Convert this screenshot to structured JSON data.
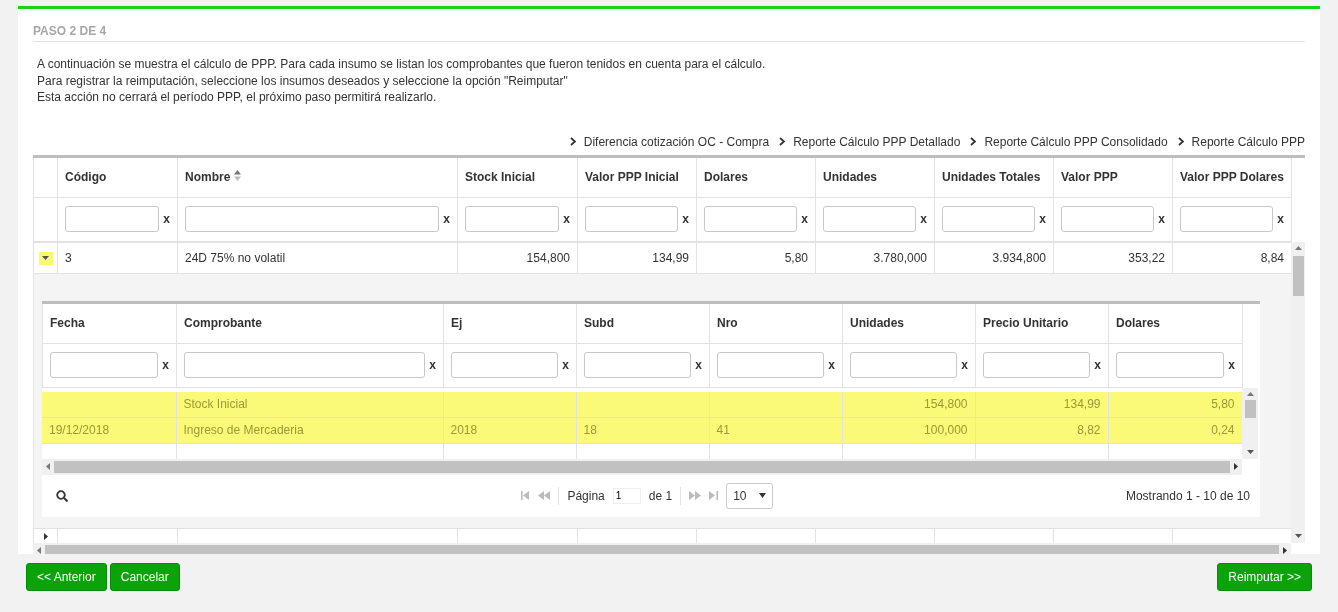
{
  "step_title": "PASO 2 DE 4",
  "intro": [
    "A continuación se muestra el cálculo de PPP. Para cada insumo se listan los comprobantes que fueron tenidos en cuenta para el cálculo.",
    "Para registrar la reimputación, seleccione los insumos deseados y seleccione la opción \"Reimputar\"",
    "Esta acción no cerrará el período PPP, el próximo paso permitirá realizarlo."
  ],
  "report_links": [
    "Diferencia cotización OC - Compra",
    "Reporte Cálculo PPP Detallado",
    "Reporte Cálculo PPP Consolidado",
    "Reporte Cálculo PPP"
  ],
  "grid": {
    "columns": [
      {
        "label": "Código",
        "kind": "text",
        "sortable": false,
        "filter_clear": "x"
      },
      {
        "label": "Nombre",
        "kind": "text",
        "sortable": true,
        "filter_clear": "x"
      },
      {
        "label": "Stock Inicial",
        "kind": "number",
        "sortable": false,
        "filter_clear": "x"
      },
      {
        "label": "Valor PPP Inicial",
        "kind": "number",
        "sortable": false,
        "filter_clear": "x"
      },
      {
        "label": "Dolares",
        "kind": "number",
        "sortable": false,
        "filter_clear": "x"
      },
      {
        "label": "Unidades",
        "kind": "number",
        "sortable": false,
        "filter_clear": "x"
      },
      {
        "label": "Unidades Totales",
        "kind": "number",
        "sortable": false,
        "filter_clear": "x"
      },
      {
        "label": "Valor PPP",
        "kind": "number",
        "sortable": false,
        "filter_clear": "x"
      },
      {
        "label": "Valor PPP Dolares",
        "kind": "number",
        "sortable": false,
        "filter_clear": "x"
      }
    ],
    "rows": [
      {
        "expanded": true,
        "cells": [
          "3",
          "24D 75% no volatil",
          "154,800",
          "134,99",
          "5,80",
          "3.780,000",
          "3.934,800",
          "353,22",
          "8,84"
        ],
        "detail": {
          "columns": [
            {
              "label": "Fecha",
              "kind": "text",
              "filter_clear": "x"
            },
            {
              "label": "Comprobante",
              "kind": "text",
              "filter_clear": "x"
            },
            {
              "label": "Ej",
              "kind": "text",
              "filter_clear": "x"
            },
            {
              "label": "Subd",
              "kind": "text",
              "filter_clear": "x"
            },
            {
              "label": "Nro",
              "kind": "text",
              "filter_clear": "x"
            },
            {
              "label": "Unidades",
              "kind": "number",
              "filter_clear": "x"
            },
            {
              "label": "Precio Unitario",
              "kind": "number",
              "filter_clear": "x"
            },
            {
              "label": "Dolares",
              "kind": "number",
              "filter_clear": "x"
            }
          ],
          "rows": [
            {
              "selected": true,
              "cells": [
                "",
                "Stock Inicial",
                "",
                "",
                "",
                "154,800",
                "134,99",
                "5,80"
              ]
            },
            {
              "selected": true,
              "cells": [
                "19/12/2018",
                "Ingreso de Mercaderia",
                "2018",
                "18",
                "41",
                "100,000",
                "8,82",
                "0,24"
              ]
            }
          ],
          "pager": {
            "page_label": "Página",
            "page": "1",
            "of_label": "de 1",
            "page_size": "10",
            "summary": "Mostrando 1 - 10 de 10"
          }
        }
      },
      {
        "expanded": false,
        "cells": []
      }
    ]
  },
  "left_buttons": [
    "<< Anterior",
    "Cancelar"
  ],
  "right_buttons": [
    "Reimputar >>"
  ]
}
